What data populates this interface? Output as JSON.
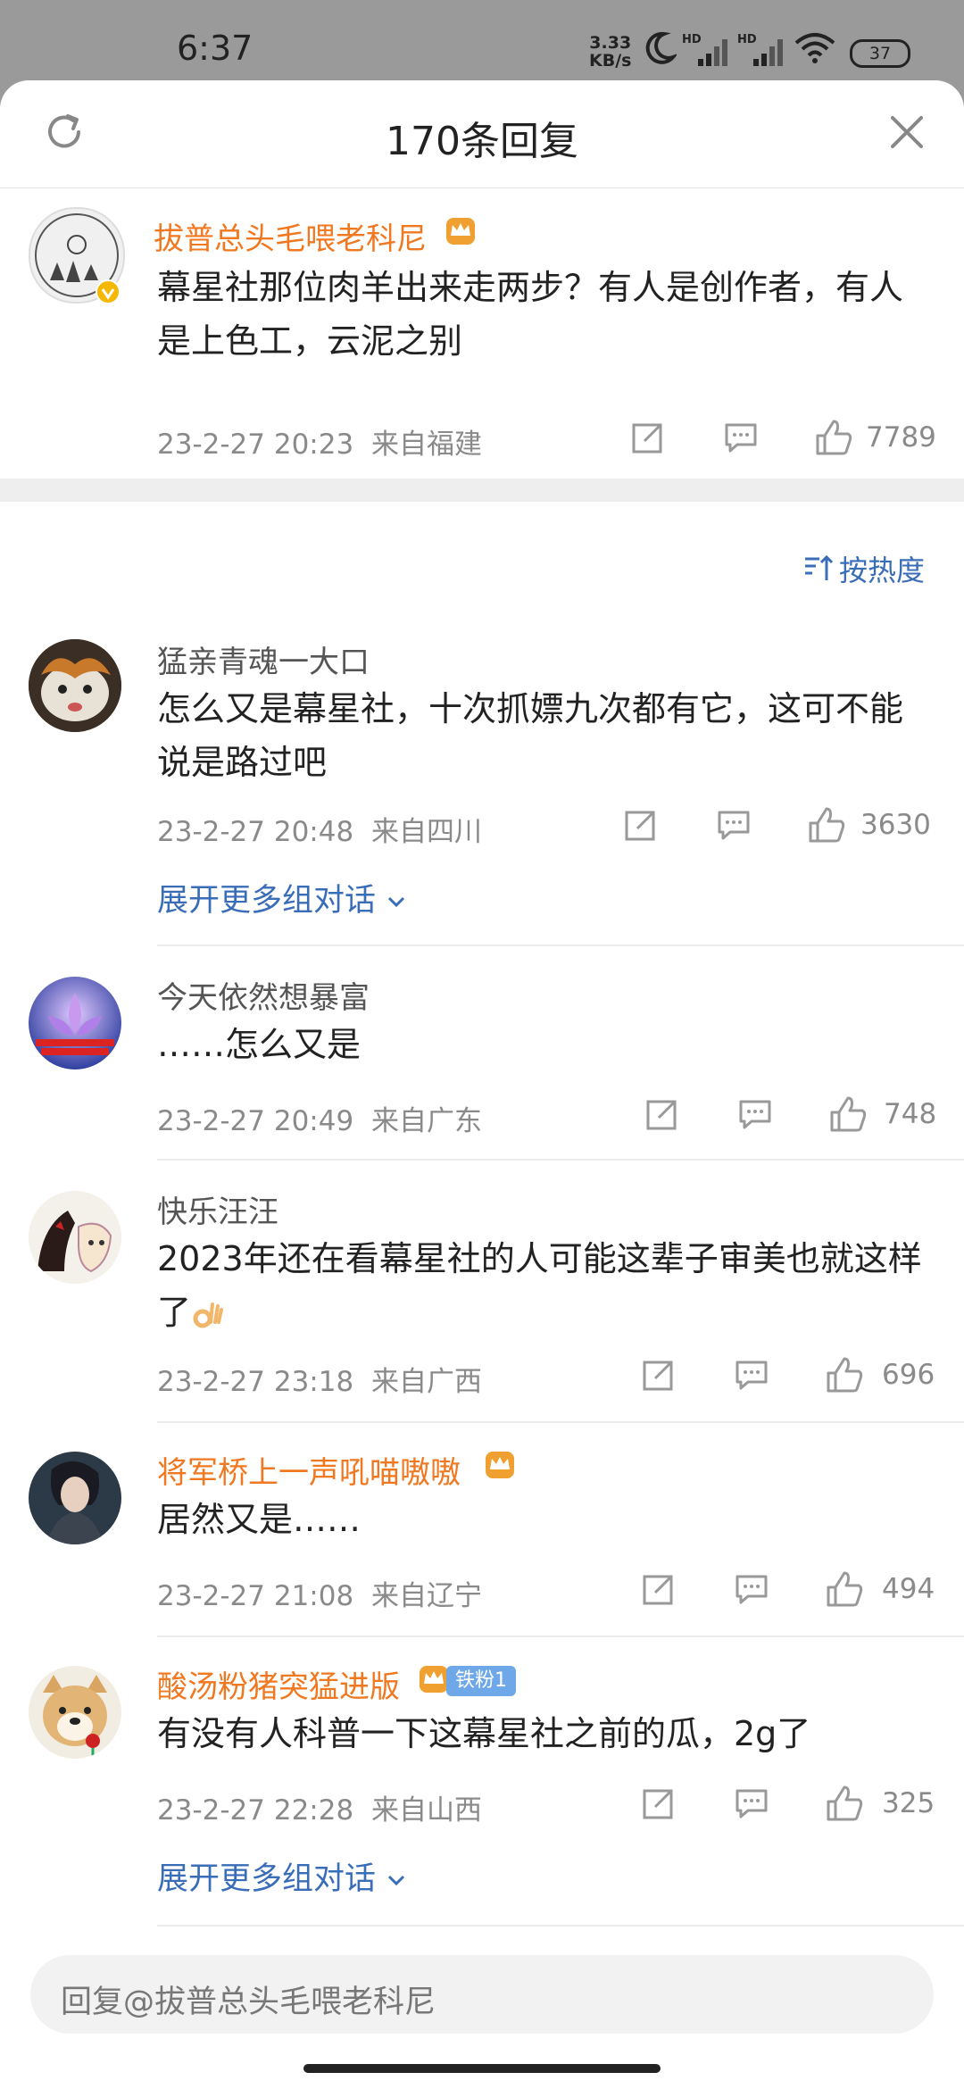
{
  "status": {
    "time": "6:37",
    "net_speed_value": "3.33",
    "net_speed_unit": "KB/s",
    "battery": "37"
  },
  "sheet": {
    "title": "170条回复",
    "refresh_icon": "refresh-icon",
    "close_icon": "close-icon"
  },
  "root_comment": {
    "username": "拔普总头毛喂老科尼",
    "text": "幕星社那位肉羊出来走两步？有人是创作者，有人是上色工，云泥之别",
    "time": "23-2-27 20:23",
    "location": "来自福建",
    "likes": "7789"
  },
  "sort": {
    "label": "按热度"
  },
  "comments": [
    {
      "username": "猛亲青魂一大口",
      "text": "怎么又是幕星社，十次抓嫖九次都有它，这可不能说是路过吧",
      "time": "23-2-27 20:48",
      "location": "来自四川",
      "likes": "3630",
      "more": "展开更多组对话"
    },
    {
      "username": "今天依然想暴富",
      "text": "……怎么又是",
      "time": "23-2-27 20:49",
      "location": "来自广东",
      "likes": "748"
    },
    {
      "username": "快乐汪汪",
      "text": "2023年还在看幕星社的人可能这辈子审美也就这样了",
      "time": "23-2-27 23:18",
      "location": "来自广西",
      "likes": "696"
    },
    {
      "username": "将军桥上一声吼喵嗷嗷",
      "text": "居然又是……",
      "time": "23-2-27 21:08",
      "location": "来自辽宁",
      "likes": "494"
    },
    {
      "username": "酸汤粉猪突猛进版",
      "badge": "铁粉1",
      "text": "有没有人科普一下这幕星社之前的瓜，2g了",
      "time": "23-2-27 22:28",
      "location": "来自山西",
      "likes": "325",
      "more": "展开更多组对话"
    }
  ],
  "reply_bar": {
    "placeholder": "回复@拔普总头毛喂老科尼"
  },
  "colors": {
    "accent_blue": "#3a6db8",
    "vip_orange": "#f07820"
  }
}
